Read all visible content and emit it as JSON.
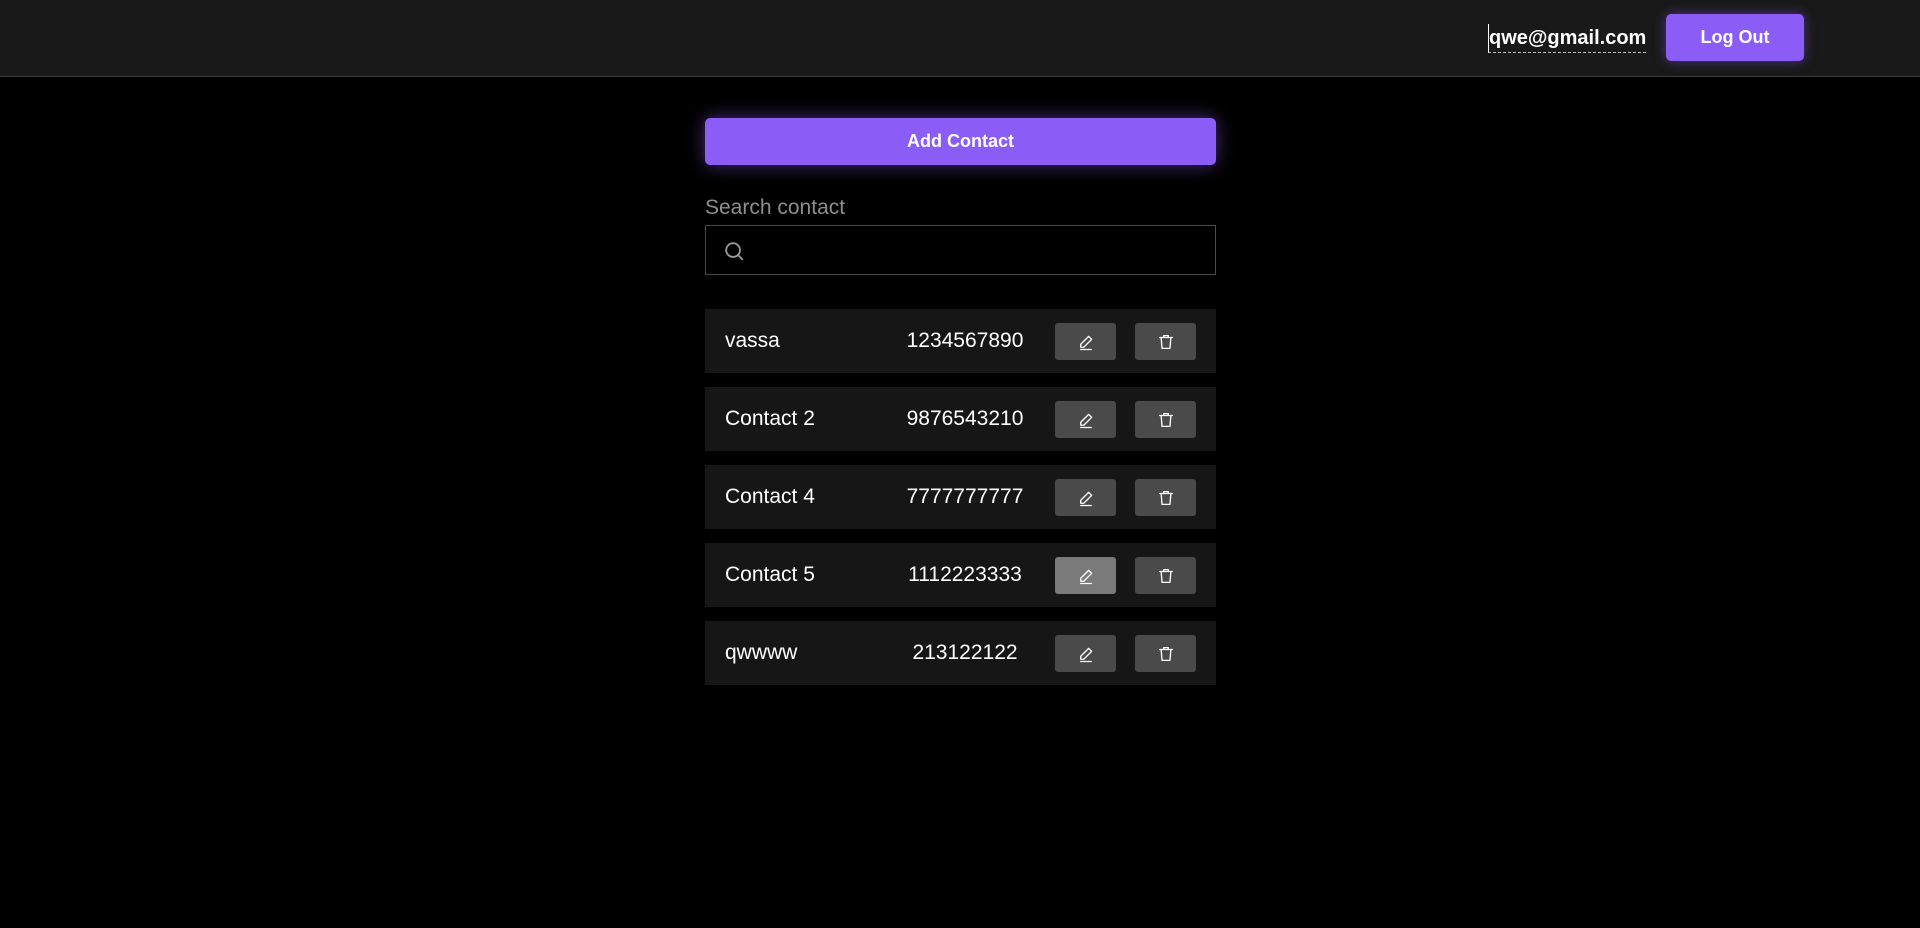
{
  "header": {
    "user_email": "qwe@gmail.com",
    "logout_label": "Log Out"
  },
  "main": {
    "add_contact_label": "Add Contact",
    "search_label": "Search contact",
    "search_value": "",
    "search_icon": "search-icon"
  },
  "contacts": [
    {
      "name": "vassa",
      "phone": "1234567890"
    },
    {
      "name": "Contact 2",
      "phone": "9876543210"
    },
    {
      "name": "Contact 4",
      "phone": "7777777777"
    },
    {
      "name": "Contact 5",
      "phone": "1112223333"
    },
    {
      "name": "qwwww",
      "phone": "213122122"
    }
  ],
  "icons": {
    "edit": "pencil-icon",
    "delete": "trash-icon"
  },
  "colors": {
    "accent": "#8b5cf6",
    "background": "#000000",
    "header_bg": "#191919",
    "row_bg": "#161616",
    "icon_button_bg": "#4a4a4a"
  }
}
